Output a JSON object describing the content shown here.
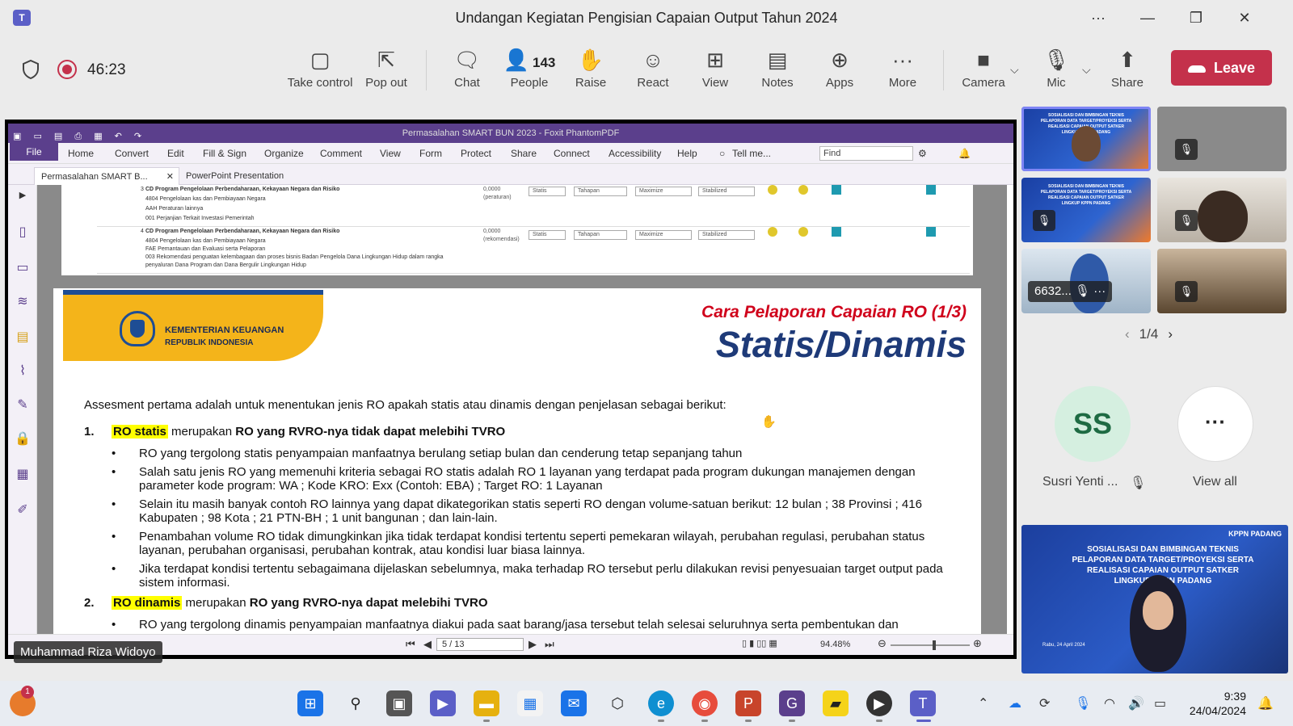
{
  "window": {
    "title": "Undangan Kegiatan Pengisian Capaian Output Tahun 2024",
    "more_label": "···",
    "minimize_label": "—",
    "maximize_label": "❐",
    "close_label": "✕"
  },
  "meeting_bar": {
    "timer": "46:23",
    "buttons": [
      {
        "label": "Take control",
        "icon": "take-control-icon",
        "glyph": "▢"
      },
      {
        "label": "Pop out",
        "icon": "pop-out-icon",
        "glyph": "⇱"
      },
      {
        "label": "Chat",
        "icon": "chat-icon",
        "glyph": "💬"
      },
      {
        "label": "People",
        "icon": "people-icon",
        "glyph": "👤",
        "count": "143"
      },
      {
        "label": "Raise",
        "icon": "raise-hand-icon",
        "glyph": "✋"
      },
      {
        "label": "React",
        "icon": "react-icon",
        "glyph": "☺"
      },
      {
        "label": "View",
        "icon": "view-icon",
        "glyph": "⊞"
      },
      {
        "label": "Notes",
        "icon": "notes-icon",
        "glyph": "📋"
      },
      {
        "label": "Apps",
        "icon": "apps-icon",
        "glyph": "⊕"
      },
      {
        "label": "More",
        "icon": "more-icon",
        "glyph": "···"
      },
      {
        "label": "Camera",
        "icon": "camera-icon",
        "glyph": "■"
      },
      {
        "label": "Mic",
        "icon": "mic-off-icon",
        "glyph": "🎙"
      },
      {
        "label": "Share",
        "icon": "share-icon",
        "glyph": "⬆"
      }
    ],
    "leave_label": "Leave",
    "leave_color": "#c4314b"
  },
  "pdf_app": {
    "title": "Permasalahan SMART BUN 2023 - Foxit PhantomPDF",
    "file_label": "File",
    "menu": [
      "Home",
      "Convert",
      "Edit",
      "Fill & Sign",
      "Organize",
      "Comment",
      "View",
      "Form",
      "Protect",
      "Share",
      "Connect",
      "Accessibility",
      "Help"
    ],
    "tell_me": "Tell me...",
    "find_placeholder": "Find",
    "tabs": [
      {
        "label": "Permasalahan SMART B..."
      },
      {
        "label": "PowerPoint Presentation"
      }
    ],
    "tab_close": "✕",
    "page_display": "5 / 13",
    "zoom": "94.48%",
    "zoom_fraction": 0.55,
    "accent_color": "#5b3f8c"
  },
  "prev_page": {
    "rows": [
      {
        "number": "3",
        "lines": [
          "CD Program Pengelolaan Perbendaharaan, Kekayaan Negara dan Risiko",
          "4804 Pengelolaan kas dan Pembiayaan Negara",
          "AAH Peraturan lainnya",
          "001 Perjanjian Terkait Investasi Pemerintah"
        ],
        "value": "0,0000",
        "value_note": "(peraturan)",
        "selects": [
          "Statis",
          "Tahapan",
          "Maximize",
          "Stabilized"
        ]
      },
      {
        "number": "4",
        "lines": [
          "CD Program Pengelolaan Perbendaharaan, Kekayaan Negara dan Risiko",
          "4804 Pengelolaan kas dan Pembiayaan Negara",
          "FAE Pemantauan dan Evaluasi serta Pelaporan",
          "003 Rekomendasi penguatan kelembagaan dan proses bisnis Badan Pengelola Dana Lingkungan Hidup dalam rangka",
          "penyaluran Dana Program dan Dana Bergulir Lingkungan Hidup"
        ],
        "value": "0,0000",
        "value_note": "(rekomendasi)",
        "selects": [
          "Statis",
          "Tahapan",
          "Maximize",
          "Stabilized"
        ]
      }
    ]
  },
  "slide": {
    "org_name": "KEMENTERIAN KEUANGAN",
    "org_sub": "REPUBLIK INDONESIA",
    "subtitle": "Cara Pelaporan Capaian RO (1/3)",
    "title": "Statis/Dinamis",
    "intro": "Assesment pertama adalah untuk menentukan jenis RO apakah statis atau dinamis dengan penjelasan sebagai berikut:",
    "items": [
      {
        "number": "1.",
        "highlight": "RO statis",
        "mid": " merupakan ",
        "bold": "RO yang RVRO-nya tidak dapat melebihi TVRO",
        "bullets": [
          "RO yang tergolong statis penyampaian manfaatnya berulang setiap bulan dan cenderung tetap sepanjang tahun",
          "Salah satu jenis RO yang memenuhi kriteria sebagai RO statis adalah RO 1 layanan yang terdapat pada program dukungan manajemen dengan parameter kode program: WA ; Kode KRO: Exx (Contoh: EBA) ; Target RO: 1 Layanan",
          "Selain itu masih banyak contoh RO lainnya yang dapat dikategorikan statis seperti RO dengan volume-satuan berikut: 12 bulan ; 38 Provinsi ; 416 Kabupaten ; 98 Kota ; 21 PTN-BH ; 1 unit bangunan ; dan lain-lain.",
          "Penambahan volume RO tidak dimungkinkan jika tidak terdapat kondisi tertentu seperti pemekaran wilayah, perubahan regulasi, perubahan status layanan, perubahan organisasi, perubahan kontrak, atau kondisi luar biasa lainnya.",
          "Jika terdapat kondisi tertentu sebagaimana dijelaskan sebelumnya, maka terhadap RO tersebut perlu dilakukan revisi penyesuaian target output pada sistem informasi."
        ]
      },
      {
        "number": "2.",
        "highlight": "RO dinamis",
        "mid": " merupakan ",
        "bold": "RO yang RVRO-nya dapat melebihi TVRO",
        "bullets": [
          "RO yang tergolong dinamis penyampaian manfaatnya diakui pada saat barang/jasa tersebut telah selesai seluruhnya serta pembentukan dan"
        ]
      }
    ]
  },
  "presenter_name": "Muhammad Riza Widoyo",
  "gallery": {
    "tiles": [
      {
        "label": "",
        "kind": "slide",
        "muted": false
      },
      {
        "label": "",
        "kind": "blank",
        "muted": true
      },
      {
        "label": "",
        "kind": "slide",
        "muted": true
      },
      {
        "label": "",
        "kind": "person",
        "muted": true
      },
      {
        "label": "6632...",
        "kind": "person",
        "muted": true
      },
      {
        "label": "",
        "kind": "room",
        "muted": true
      }
    ],
    "tile_slide_caption": "SOSIALISASI DAN BIMBINGAN TEKNIS PELAPORAN DATA TARGET/PROYEKSI SERTA REALISASI CAPAIAN OUTPUT SATKER LINGKUP KPPN PADANG",
    "page_label": "1/4",
    "participants": [
      {
        "initials": "SS",
        "name": "Susri Yenti ...",
        "muted": true
      },
      {
        "initials": "···",
        "name": "View all"
      }
    ]
  },
  "self_view": {
    "title": "SOSIALISASI DAN BIMBINGAN TEKNIS PELAPORAN DATA TARGET/PROYEKSI SERTA REALISASI CAPAIAN OUTPUT SATKER LINGKUP KPPN PADANG",
    "badge": "KPPN PADANG",
    "date": "Rabu, 24 April 2024"
  },
  "taskbar": {
    "notification_count": "1",
    "time": "9:39",
    "date": "24/04/2024"
  }
}
